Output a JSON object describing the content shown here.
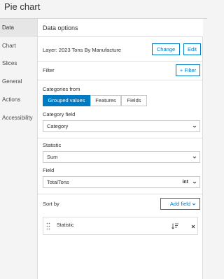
{
  "window": {
    "title": "Pie chart"
  },
  "sidebar": {
    "items": [
      {
        "label": "Data",
        "active": true
      },
      {
        "label": "Chart",
        "active": false
      },
      {
        "label": "Slices",
        "active": false
      },
      {
        "label": "General",
        "active": false
      },
      {
        "label": "Actions",
        "active": false
      },
      {
        "label": "Accessibility",
        "active": false
      }
    ]
  },
  "panel": {
    "header": "Data options",
    "layer_label": "Layer: 2023 Tons By Manufacture",
    "change_button": "Change",
    "edit_button": "Edit",
    "filter_label": "Filter",
    "filter_button": "+ Filter",
    "categories_from_label": "Categories from",
    "categories_options": [
      "Grouped values",
      "Features",
      "Fields"
    ],
    "categories_selected": "Grouped values",
    "category_field_label": "Category field",
    "category_field_value": "Category",
    "statistic_label": "Statistic",
    "statistic_value": "Sum",
    "field_label": "Field",
    "field_value": "TotalTons",
    "field_type_badge": "int",
    "sort_by_label": "Sort by",
    "add_field_button": "Add field",
    "sort_item_label": "Statistic",
    "accent_color": "#007ac2"
  }
}
